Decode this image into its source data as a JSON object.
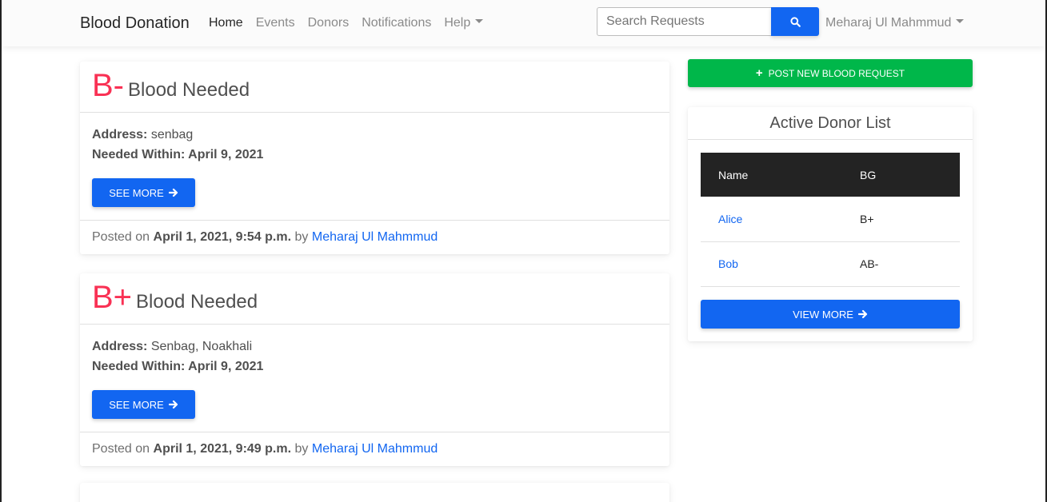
{
  "nav": {
    "brand": "Blood Donation",
    "links": [
      "Home",
      "Events",
      "Donors",
      "Notifications",
      "Help"
    ],
    "search_placeholder": "Search Requests",
    "user": "Meharaj Ul Mahmmud"
  },
  "requests": [
    {
      "blood_group": "B-",
      "heading": "Blood Needed",
      "address_label": "Address:",
      "address": "senbag",
      "needed_label": "Needed Within:",
      "needed_date": "April 9, 2021",
      "button": "SEE MORE",
      "posted_prefix": "Posted on",
      "posted_date": "April 1, 2021, 9:54 p.m.",
      "by": "by",
      "author": "Meharaj Ul Mahmmud"
    },
    {
      "blood_group": "B+",
      "heading": "Blood Needed",
      "address_label": "Address:",
      "address": "Senbag, Noakhali",
      "needed_label": "Needed Within:",
      "needed_date": "April 9, 2021",
      "button": "SEE MORE",
      "posted_prefix": "Posted on",
      "posted_date": "April 1, 2021, 9:49 p.m.",
      "by": "by",
      "author": "Meharaj Ul Mahmmud"
    }
  ],
  "sidebar": {
    "post_button": "POST NEW BLOOD REQUEST",
    "donor_list_title": "Active Donor List",
    "table_headers": [
      "Name",
      "BG"
    ],
    "donors": [
      {
        "name": "Alice",
        "bg": "B+"
      },
      {
        "name": "Bob",
        "bg": "AB-"
      }
    ],
    "view_more": "VIEW MORE"
  },
  "colors": {
    "primary": "#1266f1",
    "success": "#00b74a",
    "danger": "#f93154",
    "dark": "#232323"
  }
}
